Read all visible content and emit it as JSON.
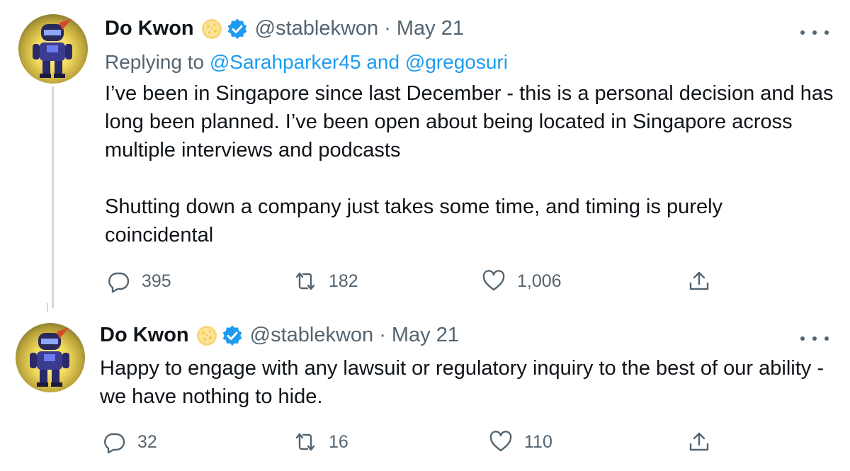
{
  "tweets": [
    {
      "author_name": "Do Kwon",
      "handle": "@stablekwon",
      "separator": "·",
      "date": "May 21",
      "replying_to_prefix": "Replying to",
      "replying_to_users": [
        "@Sarahparker45",
        "@gregosuri"
      ],
      "replying_to_joiner": "and",
      "text": "I’ve been in Singapore since last December - this is a personal decision and has long been planned. I’ve been open about being located in Singapore across multiple interviews and podcasts\n\nShutting down a company just takes some time, and timing is purely coincidental",
      "replies": "395",
      "retweets": "182",
      "likes": "1,006"
    },
    {
      "author_name": "Do Kwon",
      "handle": "@stablekwon",
      "separator": "·",
      "date": "May 21",
      "text": "Happy to engage with any lawsuit or regulatory inquiry to the best of our ability - we have nothing to hide.",
      "replies": "32",
      "retweets": "16",
      "likes": "110"
    }
  ],
  "icons": {
    "avatar": "avatar",
    "coin_badge": "coin-emoji-icon",
    "verified_badge": "verified-badge-icon",
    "more": "more-options-icon",
    "reply": "reply-icon",
    "retweet": "retweet-icon",
    "like": "heart-icon",
    "share": "share-icon"
  },
  "colors": {
    "link": "#1d9bf0",
    "secondary_text": "#536471",
    "primary_text": "#0f1419",
    "verified": "#1d9bf0"
  }
}
